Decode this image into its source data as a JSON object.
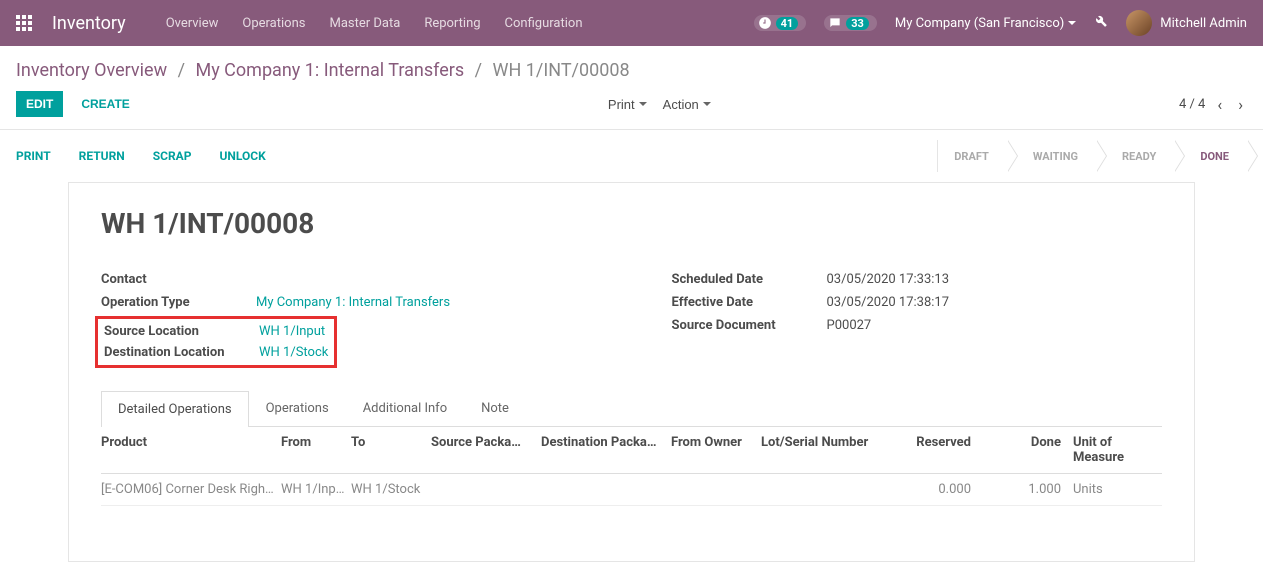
{
  "topbar": {
    "app_title": "Inventory",
    "nav": [
      "Overview",
      "Operations",
      "Master Data",
      "Reporting",
      "Configuration"
    ],
    "activity_count": "41",
    "messages_count": "33",
    "company": "My Company (San Francisco)",
    "user": "Mitchell Admin"
  },
  "breadcrumb": {
    "items": [
      "Inventory Overview",
      "My Company 1: Internal Transfers"
    ],
    "current": "WH 1/INT/00008"
  },
  "controls": {
    "edit": "EDIT",
    "create": "CREATE",
    "print": "Print",
    "action": "Action",
    "pager": "4 / 4"
  },
  "actions": {
    "print": "PRINT",
    "return": "RETURN",
    "scrap": "SCRAP",
    "unlock": "UNLOCK"
  },
  "status_steps": [
    "DRAFT",
    "WAITING",
    "READY",
    "DONE"
  ],
  "record": {
    "title": "WH 1/INT/00008",
    "left": {
      "contact_label": "Contact",
      "contact_value": "",
      "op_type_label": "Operation Type",
      "op_type_value": "My Company 1: Internal Transfers",
      "src_loc_label": "Source Location",
      "src_loc_value": "WH 1/Input",
      "dst_loc_label": "Destination Location",
      "dst_loc_value": "WH 1/Stock"
    },
    "right": {
      "sched_label": "Scheduled Date",
      "sched_value": "03/05/2020 17:33:13",
      "eff_label": "Effective Date",
      "eff_value": "03/05/2020 17:38:17",
      "srcdoc_label": "Source Document",
      "srcdoc_value": "P00027"
    }
  },
  "tabs": [
    "Detailed Operations",
    "Operations",
    "Additional Info",
    "Note"
  ],
  "table": {
    "headers": {
      "product": "Product",
      "from": "From",
      "to": "To",
      "srcpkg": "Source Packa…",
      "dstpkg": "Destination Packa…",
      "owner": "From Owner",
      "lot": "Lot/Serial Number",
      "reserved": "Reserved",
      "done": "Done",
      "uom": "Unit of Measure"
    },
    "rows": [
      {
        "product": "[E-COM06] Corner Desk Righ…",
        "from": "WH 1/Inp…",
        "to": "WH 1/Stock",
        "srcpkg": "",
        "dstpkg": "",
        "owner": "",
        "lot": "",
        "reserved": "0.000",
        "done": "1.000",
        "uom": "Units"
      }
    ]
  }
}
